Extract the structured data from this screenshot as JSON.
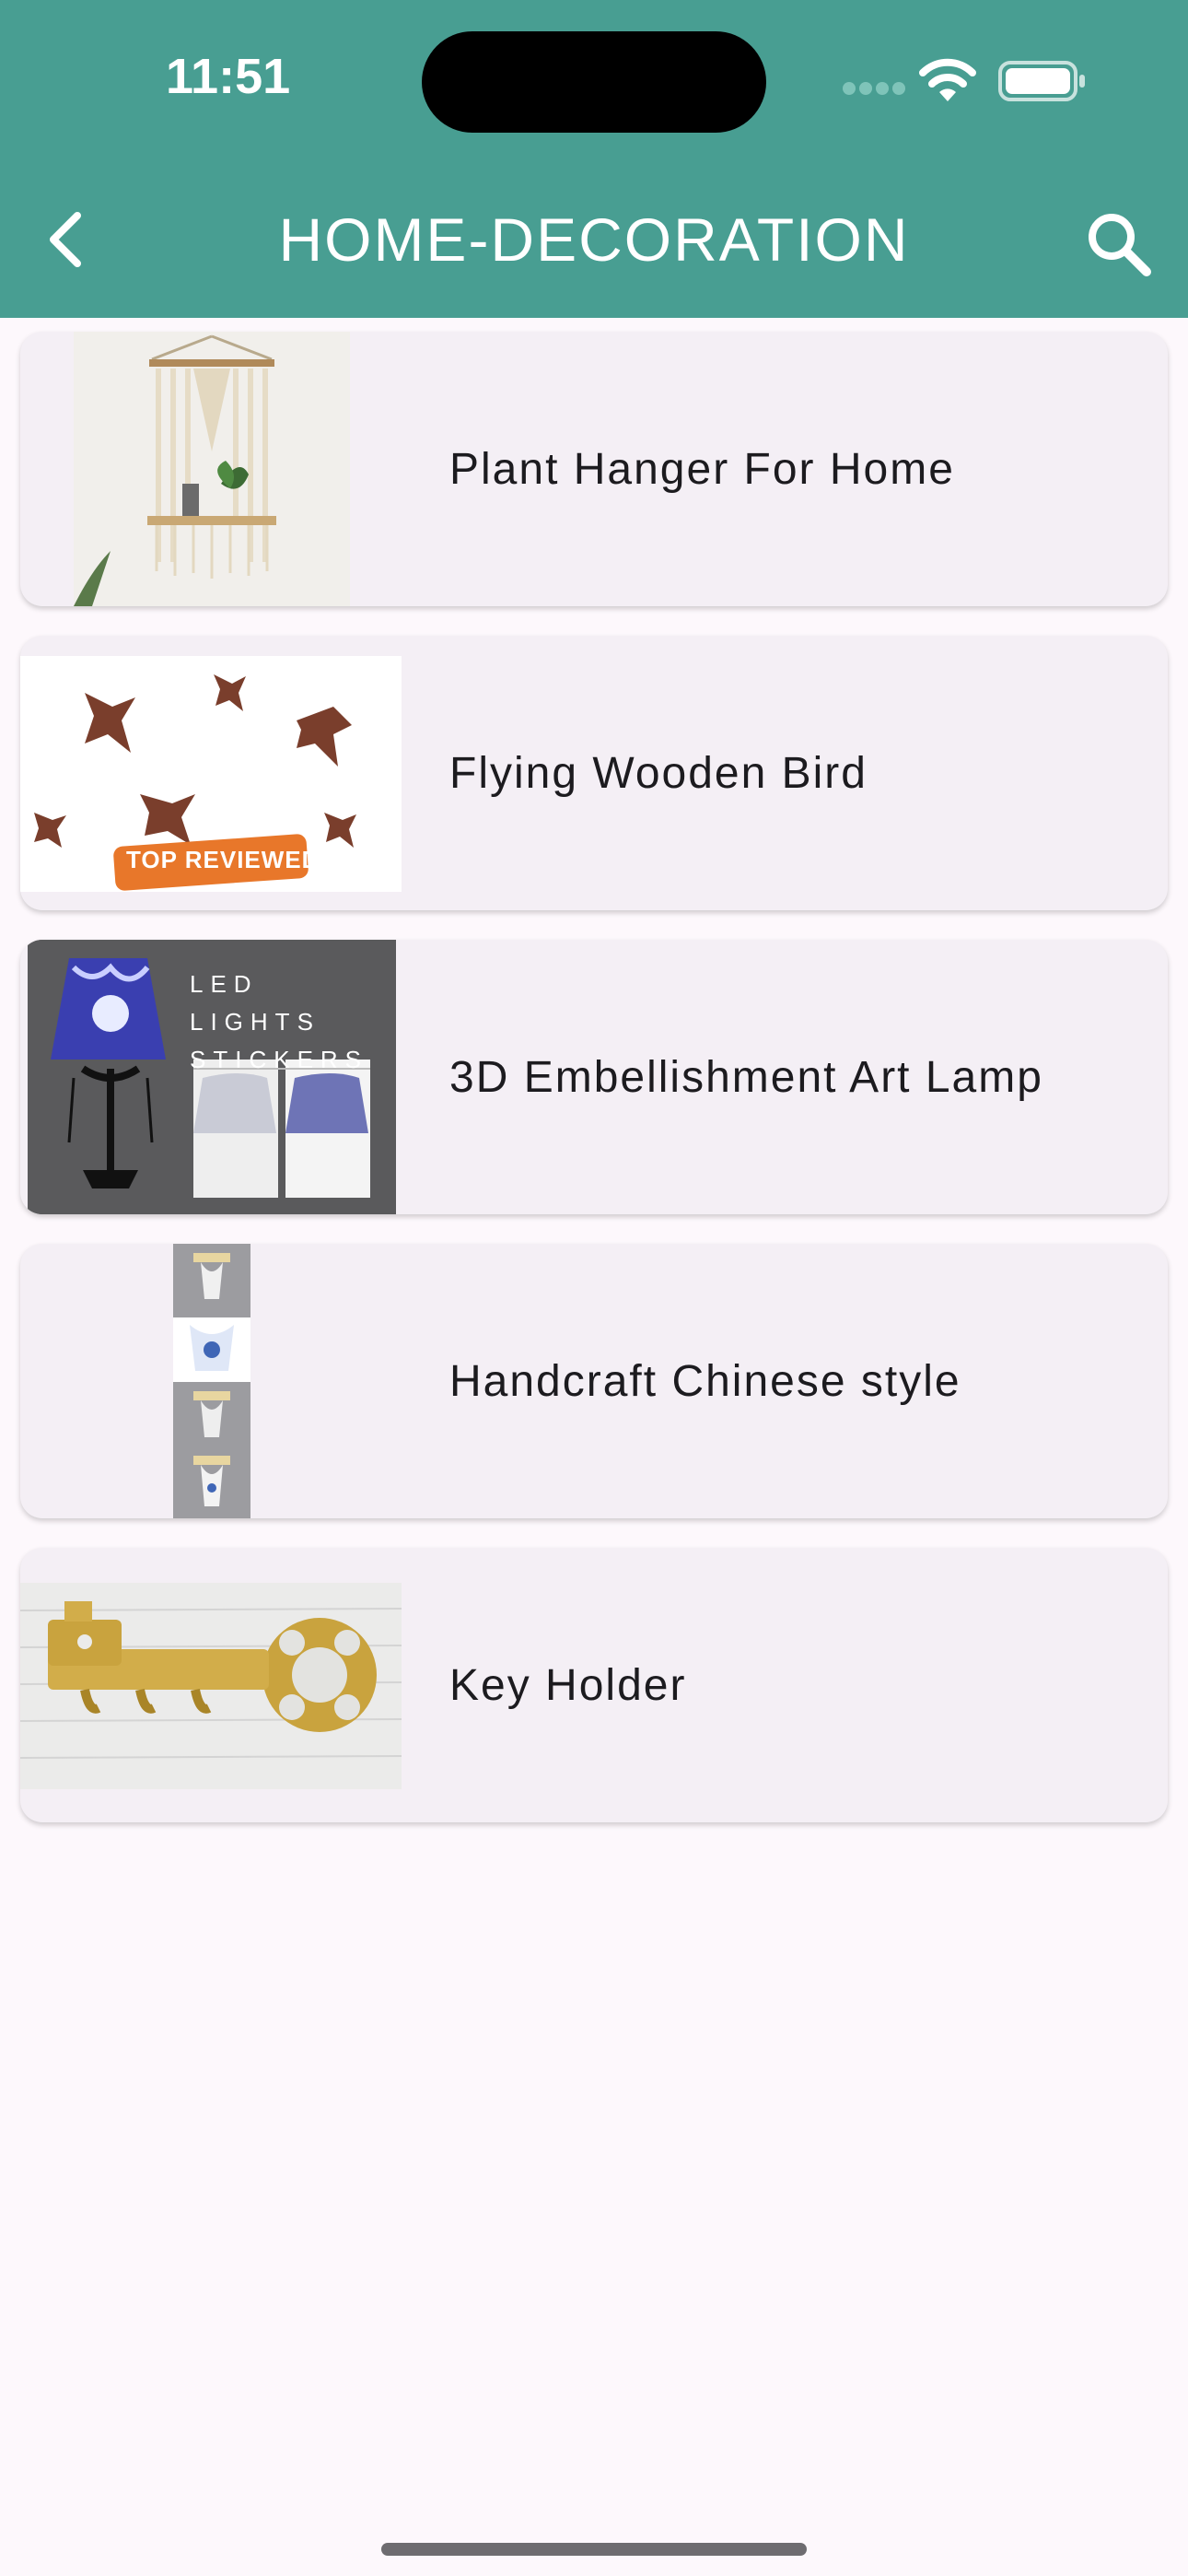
{
  "status_bar": {
    "time": "11:51"
  },
  "app_bar": {
    "title": "HOME-DECORATION",
    "back_icon": "chevron-left-icon",
    "search_icon": "search-icon",
    "background": "#489e92"
  },
  "items": [
    {
      "label": "Plant Hanger For Home"
    },
    {
      "label": "Flying Wooden Bird",
      "image_badge": "TOP REVIEWED"
    },
    {
      "label": "3D Embellishment Art Lamp",
      "image_text": [
        "LED",
        "LIGHTS",
        "STICKERS"
      ]
    },
    {
      "label": "Handcraft Chinese style"
    },
    {
      "label": "Key Holder"
    }
  ]
}
